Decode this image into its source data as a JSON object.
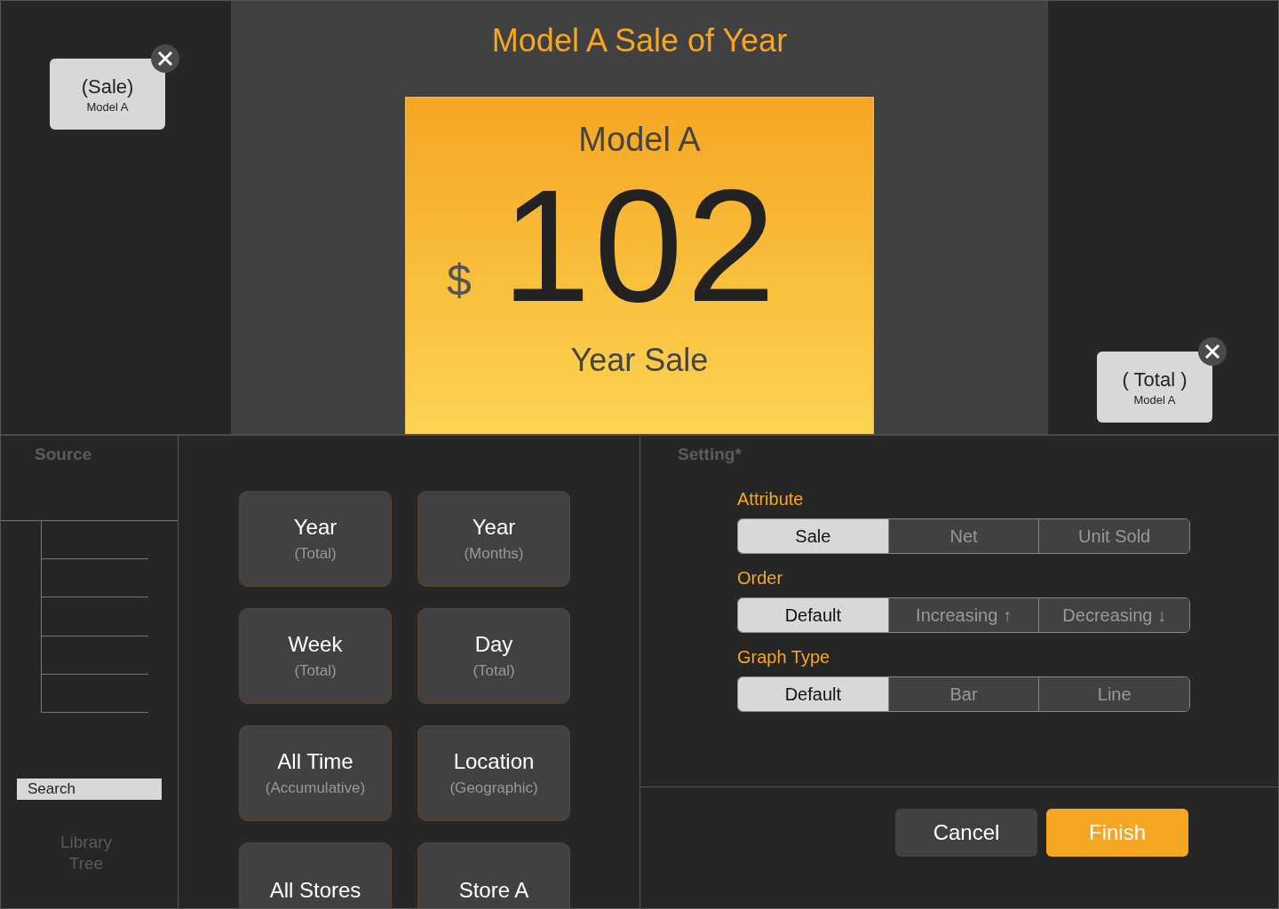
{
  "chips": [
    {
      "title": "(Sale)",
      "subtitle": "Model A"
    },
    {
      "title": "( Total )",
      "subtitle": "Model A"
    }
  ],
  "widget": {
    "title": "Model A Sale of Year",
    "card_title": "Model A",
    "currency": "$",
    "value": "102",
    "caption": "Year Sale"
  },
  "source": {
    "title": "Source",
    "search": {
      "placeholder": "Search"
    },
    "footer": "Library Tree"
  },
  "tiles": [
    {
      "title": "Year",
      "subtitle": "(Total)"
    },
    {
      "title": "Year",
      "subtitle": "(Months)"
    },
    {
      "title": "Week",
      "subtitle": "(Total)"
    },
    {
      "title": "Day",
      "subtitle": "(Total)"
    },
    {
      "title": "All Time",
      "subtitle": "(Accumulative)"
    },
    {
      "title": "Location",
      "subtitle": "(Geographic)"
    },
    {
      "title": "All Stores"
    },
    {
      "title": "Store A"
    }
  ],
  "settings": {
    "title": "Setting*",
    "groups": [
      {
        "label": "Attribute",
        "options": [
          {
            "label": "Sale",
            "selected": true
          },
          {
            "label": "Net",
            "selected": false
          },
          {
            "label": "Unit Sold",
            "selected": false
          }
        ]
      },
      {
        "label": "Order",
        "options": [
          {
            "label": "Default",
            "selected": true
          },
          {
            "label": "Increasing ↑",
            "selected": false
          },
          {
            "label": "Decreasing ↓",
            "selected": false
          }
        ]
      },
      {
        "label": "Graph Type",
        "options": [
          {
            "label": "Default",
            "selected": true
          },
          {
            "label": "Bar",
            "selected": false
          },
          {
            "label": "Line",
            "selected": false
          }
        ]
      }
    ]
  },
  "buttons": [
    {
      "label": "Cancel",
      "kind": "secondary"
    },
    {
      "label": "Finish",
      "kind": "primary"
    }
  ]
}
